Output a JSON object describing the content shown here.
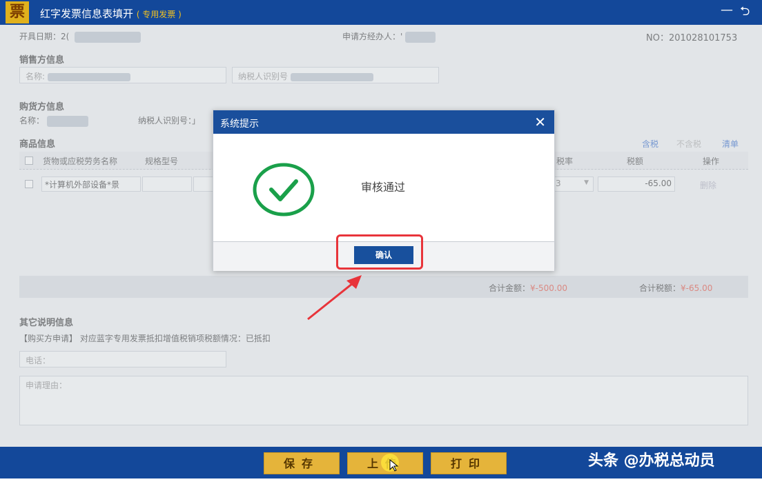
{
  "window": {
    "logo_char": "票",
    "title": "红字发票信息表填开",
    "subtitle": "( 专用发票 )",
    "minimize": "—",
    "back": "⮌"
  },
  "header": {
    "issue_date_label": "开具日期：",
    "issue_date_value": "2(",
    "applicant_label": "申请方经办人：",
    "applicant_value": "'",
    "no_label": "NO：",
    "no_value": "201028101753"
  },
  "seller": {
    "section_title": "销售方信息",
    "name_label": "名称:",
    "tax_id_label": "纳税人识别号"
  },
  "buyer": {
    "section_title": "购货方信息",
    "name_label": "名称：",
    "tax_id_label": "纳税人识别号：」"
  },
  "goods": {
    "section_title": "商品信息",
    "actions": [
      "含税",
      "不含税",
      "清单"
    ],
    "headers": [
      "货物或应税劳务名称",
      "规格型号",
      "税率",
      "税额",
      "操作"
    ],
    "row": {
      "name": "*计算机外部设备*景",
      "tax_rate": "3",
      "tax_amount": "-65.00",
      "op": "删除"
    },
    "total_amount_label": "合计金额：",
    "total_amount_value": "¥-500.00",
    "total_tax_label": "合计税额：",
    "total_tax_value": "¥-65.00"
  },
  "other": {
    "section_title": "其它说明信息",
    "statement": "【购买方申请】 对应蓝字专用发票抵扣增值税销项税额情况：已抵扣",
    "phone_placeholder": "电话：",
    "reason_placeholder": "申请理由："
  },
  "bottom_buttons": {
    "save": "保存",
    "upload": "上传",
    "print": "打印"
  },
  "watermark": "头条 @办税总动员",
  "dialog": {
    "title": "系统提示",
    "close": "✕",
    "message": "审核通过",
    "ok": "确认"
  },
  "colors": {
    "titlebar": "#13489a",
    "accent_red": "#e8343a",
    "success_green": "#1aa04a"
  }
}
